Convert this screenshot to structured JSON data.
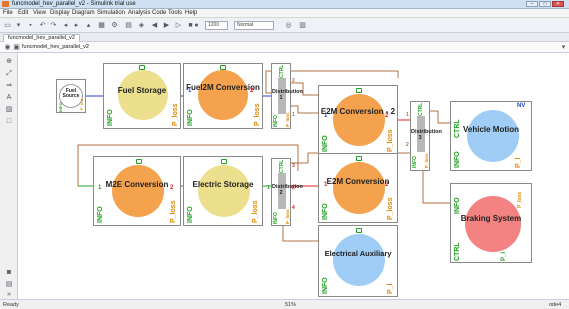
{
  "window": {
    "title": "funcmodel_hev_parallel_v2 - Simulink trial use"
  },
  "window_buttons": {
    "minimize": "–",
    "maximize": "□",
    "close": "✕"
  },
  "menu": [
    "File",
    "Edit",
    "View",
    "Display",
    "Diagram",
    "Simulation",
    "Analysis",
    "Code",
    "Tools",
    "Help"
  ],
  "toolbar": {
    "stop_time": "1200",
    "sim_mode": "Normal"
  },
  "tab": {
    "label": "funcmodel_hev_parallel_v2"
  },
  "address": {
    "path": "funcmodel_hev_parallel_v2"
  },
  "status": {
    "left": "Ready",
    "zoom": "51%",
    "solver": "ode4"
  },
  "blocks": {
    "fuel_source": {
      "title": "Fuel Source",
      "port_left": "INFO",
      "port_out": "P_out"
    },
    "fuel_storage": {
      "title": "Fuel Storage",
      "port_left": "INFO",
      "port_right": "P_loss"
    },
    "fuel2m": {
      "title": "Fuel2M Conversion",
      "port_left": "INFO",
      "port_right": "P_loss",
      "num_in": "1",
      "num_out": "2"
    },
    "dist1": {
      "title": "Distribution 1",
      "ctrl": "CTRL",
      "info": "INFO",
      "ploss": "P_loss",
      "n2": "2",
      "n1": "1"
    },
    "e2m_top": {
      "title": "E2M Conversion - 2",
      "port_left": "INFO",
      "port_right": "P_loss",
      "n1": "1",
      "n2": "2"
    },
    "dist3": {
      "title": "Distribution 3",
      "ctrl": "CTRL",
      "info": "INFO",
      "ploss": "P_loss",
      "n1": "1",
      "n2": "2"
    },
    "vehicle": {
      "title": "Vehicle Motion",
      "ctrl": "CTRL",
      "info": "INFO",
      "p": "P_l",
      "nv": "NV"
    },
    "m2e": {
      "title": "M2E Conversion",
      "port_left": "INFO",
      "port_right": "P_loss",
      "n1": "1",
      "n2": "2"
    },
    "elec_storage": {
      "title": "Electric Storage",
      "port_left": "INFO",
      "port_right": "P_loss"
    },
    "dist2": {
      "title": "Distribution 2",
      "ctrl": "CTRL",
      "info": "INFO",
      "ploss": "P_loss",
      "n1": "1",
      "n2": "2",
      "n3": "3",
      "n4": "4"
    },
    "e2m_mid": {
      "title": "E2M Conversion",
      "port_left": "INFO",
      "port_right": "P_loss",
      "n1": "1",
      "n2": "2"
    },
    "braking": {
      "title": "Braking System",
      "ctrl": "CTRL",
      "info": "INFO",
      "p": "P_l",
      "top": "P_loss"
    },
    "elec_aux": {
      "title": "Electrical Auxiliary",
      "port_left": "INFO",
      "port_right": "P_l"
    }
  },
  "colors": {
    "yellow": "#ece08e",
    "orange": "#f4a24d",
    "blue": "#9fcdf5",
    "red": "#f38282",
    "wire_brown": "#b07040",
    "wire_red": "#e02020",
    "wire_blue": "#2040c0",
    "wire_green": "#20a020"
  }
}
